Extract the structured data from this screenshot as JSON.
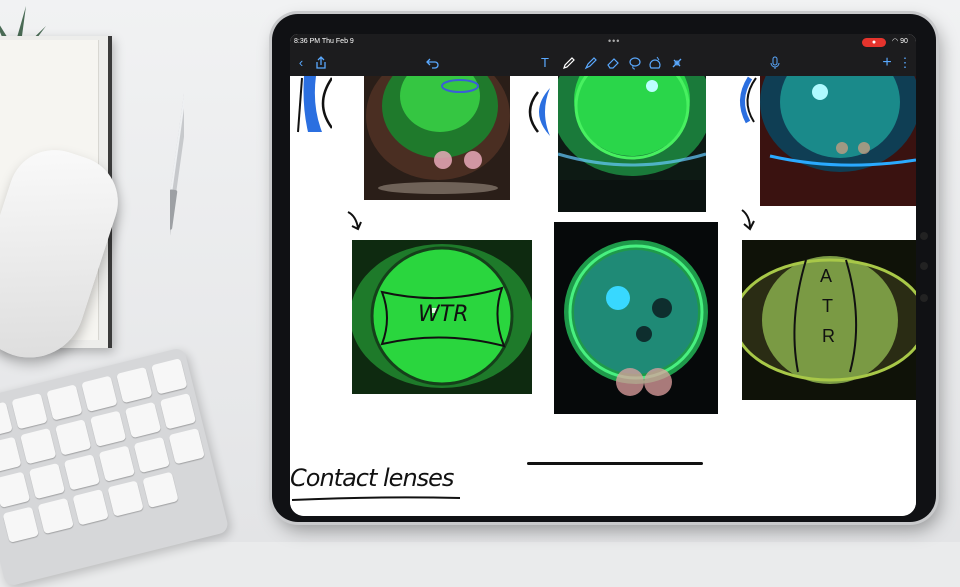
{
  "statusbar": {
    "time": "8:36 PM  Thu Feb 9",
    "dots": "•••",
    "battery": "90"
  },
  "toolbar": {
    "back_icon": "chevron-left-icon",
    "share_icon": "share-icon",
    "undo_icon": "undo-icon",
    "text_tool": "T",
    "pen_icon": "pen-icon",
    "highlighter_icon": "highlighter-icon",
    "eraser_icon": "eraser-icon",
    "lasso_icon": "lasso-icon",
    "shapes_icon": "shapes-icon",
    "laser_icon": "laser-icon",
    "mic_icon": "microphone-icon",
    "add": "+",
    "more": "⋮"
  },
  "notes": {
    "label_wtr": "WTR",
    "label_atr_a": "A",
    "label_atr_t": "T",
    "label_atr_r": "R",
    "handwritten_title": "Contact lenses"
  },
  "colors": {
    "accent": "#5aa9ff",
    "fluorescein": "#2ee84a",
    "record": "#e5342d"
  }
}
